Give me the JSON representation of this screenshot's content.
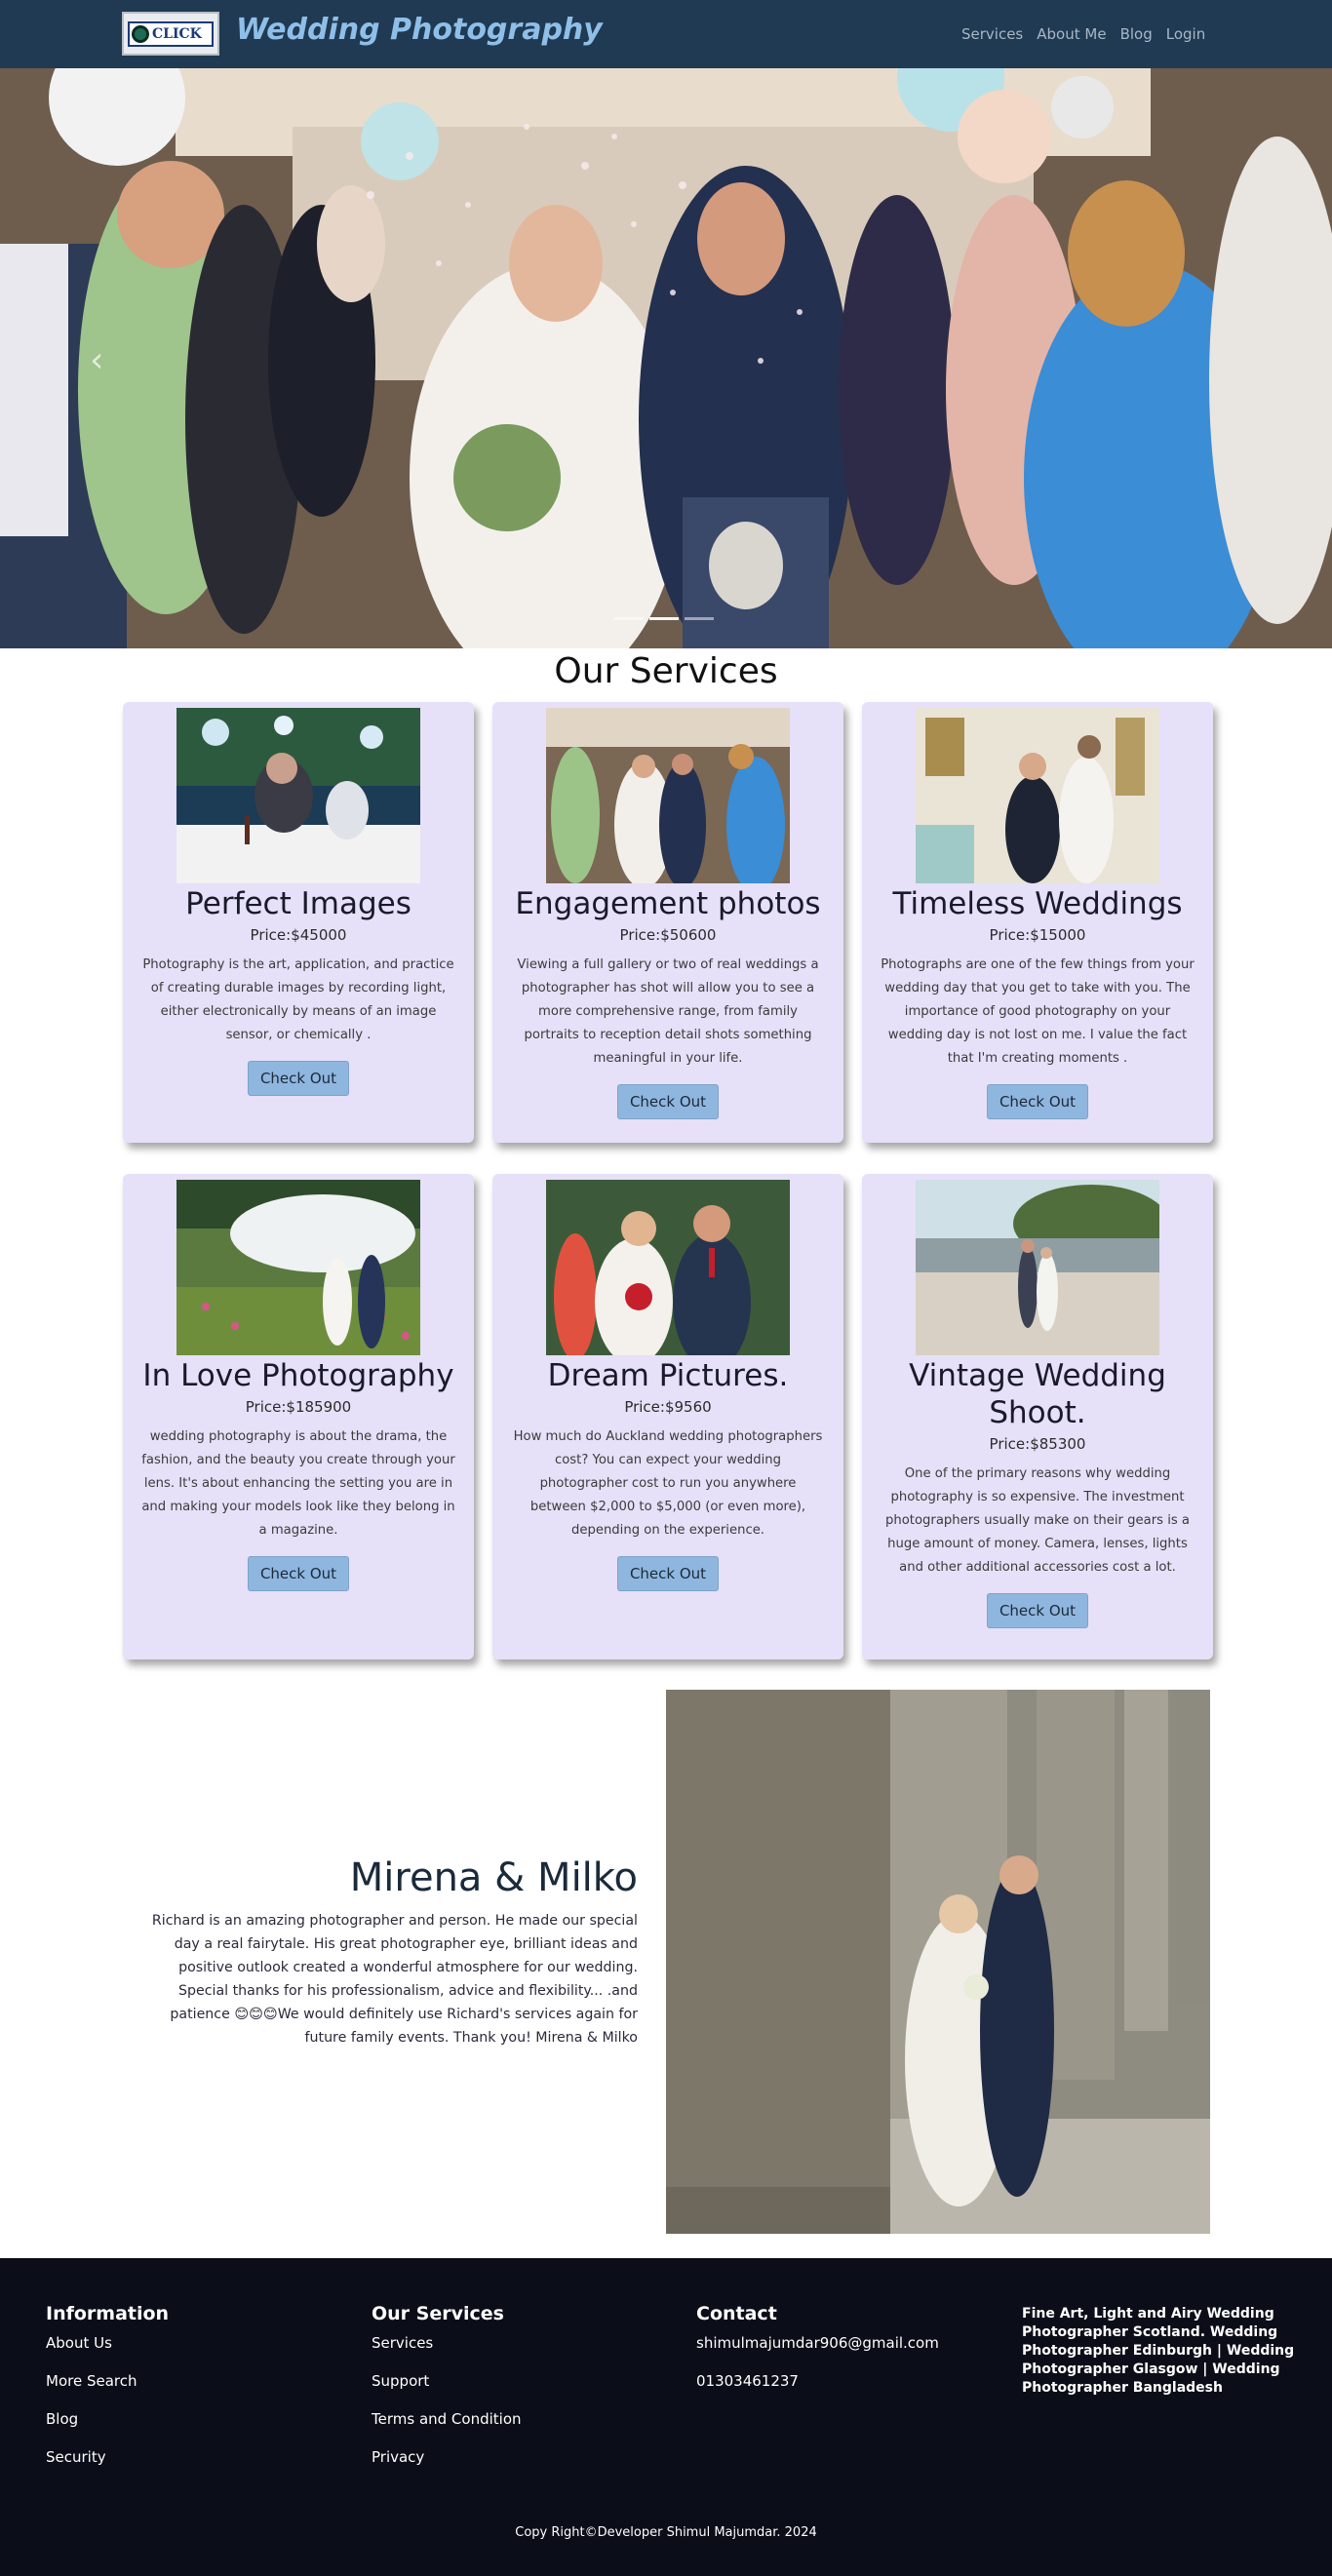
{
  "nav": {
    "logo_text": "CLICK",
    "title": "Wedding Photography",
    "links": [
      "Services",
      "About Me",
      "Blog",
      "Login"
    ]
  },
  "hero": {
    "prev_glyph": "‹",
    "active_slide": 1,
    "slide_count": 3
  },
  "services": {
    "title": "Our Services",
    "cards": [
      {
        "title": "Perfect Images",
        "price": "Price:$45000",
        "text": "Photography is the art, application, and practice of creating durable images by recording light, either electronically by means of an image sensor, or chemically .",
        "button": "Check Out"
      },
      {
        "title": "Engagement photos",
        "price": "Price:$50600",
        "text": "Viewing a full gallery or two of real weddings a photographer has shot will allow you to see a more comprehensive range, from family portraits to reception detail shots something meaningful in your life.",
        "button": "Check Out"
      },
      {
        "title": "Timeless Weddings",
        "price": "Price:$15000",
        "text": "Photographs are one of the few things from your wedding day that you get to take with you. The importance of good photography on your wedding day is not lost on me. I value the fact that I'm creating moments .",
        "button": "Check Out"
      },
      {
        "title": "In Love Photography",
        "price": "Price:$185900",
        "text": "wedding photography is about the drama, the fashion, and the beauty you create through your lens. It's about enhancing the setting you are in and making your models look like they belong in a magazine.",
        "button": "Check Out"
      },
      {
        "title": "Dream Pictures.",
        "price": "Price:$9560",
        "text": "How much do Auckland wedding photographers cost? You can expect your wedding photographer cost to run you anywhere between $2,000 to $5,000 (or even more), depending on the experience.",
        "button": "Check Out"
      },
      {
        "title": "Vintage Wedding Shoot.",
        "price": "Price:$85300",
        "text": "One of the primary reasons why wedding photography is so expensive. The investment photographers usually make on their gears is a huge amount of money. Camera, lenses, lights and other additional accessories cost a lot.",
        "button": "Check Out"
      }
    ]
  },
  "testimonial": {
    "name": "Mirena & Milko",
    "text": "Richard is an amazing photographer and person. He made our special day a real fairytale. His great photographer eye, brilliant ideas and positive outlook created a wonderful atmosphere for our wedding. Special thanks for his professionalism, advice and flexibility... .and patience 😊😊😊We would definitely use Richard's services again for future family events. Thank you! Mirena & Milko"
  },
  "footer": {
    "information": {
      "heading": "Information",
      "items": [
        "About Us",
        "More Search",
        "Blog",
        "Security"
      ]
    },
    "our_services": {
      "heading": "Our Services",
      "items": [
        "Services",
        "Support",
        "Terms and Condition",
        "Privacy"
      ]
    },
    "contact": {
      "heading": "Contact",
      "email": "shimulmajumdar906@gmail.com",
      "phone": "01303461237"
    },
    "about_text": "Fine Art, Light and Airy Wedding Photographer Scotland. Wedding Photographer Edinburgh | Wedding Photographer Glasgow | Wedding Photographer Bangladesh",
    "copyright": "Copy Right©Developer Shimul Majumdar. 2024"
  },
  "colors": {
    "navbar": "#1f3a52",
    "brand_title": "#8fbfe8",
    "card_bg": "#e6e0f8",
    "button": "#8fb6de",
    "footer": "#0b0e18"
  }
}
